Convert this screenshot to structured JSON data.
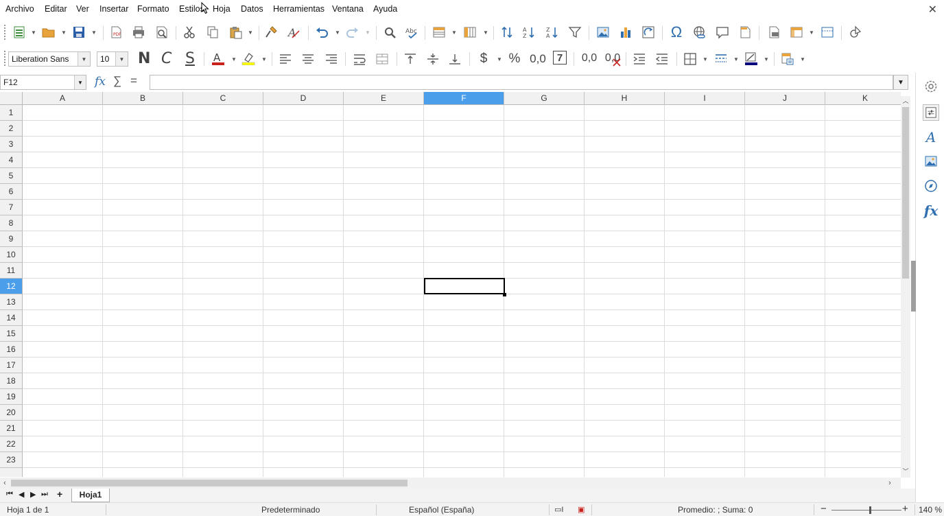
{
  "menu": {
    "items": [
      "Archivo",
      "Editar",
      "Ver",
      "Insertar",
      "Formato",
      "Estilos",
      "Hoja",
      "Datos",
      "Herramientas",
      "Ventana",
      "Ayuda"
    ],
    "close_glyph": "✕"
  },
  "toolbar": {
    "font_name": "Liberation Sans",
    "font_size": "10",
    "bold_label": "N",
    "italic_label": "C",
    "strike_label": "S",
    "currency_label": "$",
    "percent_label": "%",
    "number_label": "0,0",
    "date_label": "7",
    "add_decimal_label": "0,0",
    "del_decimal_label": "0,0",
    "font_color": "#c9211e",
    "highlight_color": "#ffff00",
    "border_color": "#000080"
  },
  "formula_bar": {
    "name_box": "F12",
    "fx_label": "fx",
    "sum_label": "∑",
    "equals_label": "=",
    "content": ""
  },
  "grid": {
    "columns": [
      "A",
      "B",
      "C",
      "D",
      "E",
      "F",
      "G",
      "H",
      "I",
      "J",
      "K"
    ],
    "rows": [
      "1",
      "2",
      "3",
      "4",
      "5",
      "6",
      "7",
      "8",
      "9",
      "10",
      "11",
      "12",
      "13",
      "14",
      "15",
      "16",
      "17",
      "18",
      "19",
      "20",
      "21",
      "22",
      "23"
    ],
    "selected_column": "F",
    "selected_row": "12",
    "selection_color": "#4a9eea"
  },
  "sheets": {
    "tabs": [
      "Hoja1"
    ],
    "active": "Hoja1",
    "add_label": "+"
  },
  "status": {
    "sheet_info": "Hoja 1 de 1",
    "page_style": "Predeterminado",
    "language": "Español (España)",
    "summary": "Promedio: ; Suma: 0",
    "zoom_minus": "−",
    "zoom_plus": "+",
    "zoom": "140 %",
    "zoom_level_percent": 140
  },
  "sidebar": {
    "icons": [
      "properties-icon",
      "styles-icon",
      "gallery-icon",
      "navigator-icon",
      "functions-icon"
    ]
  }
}
